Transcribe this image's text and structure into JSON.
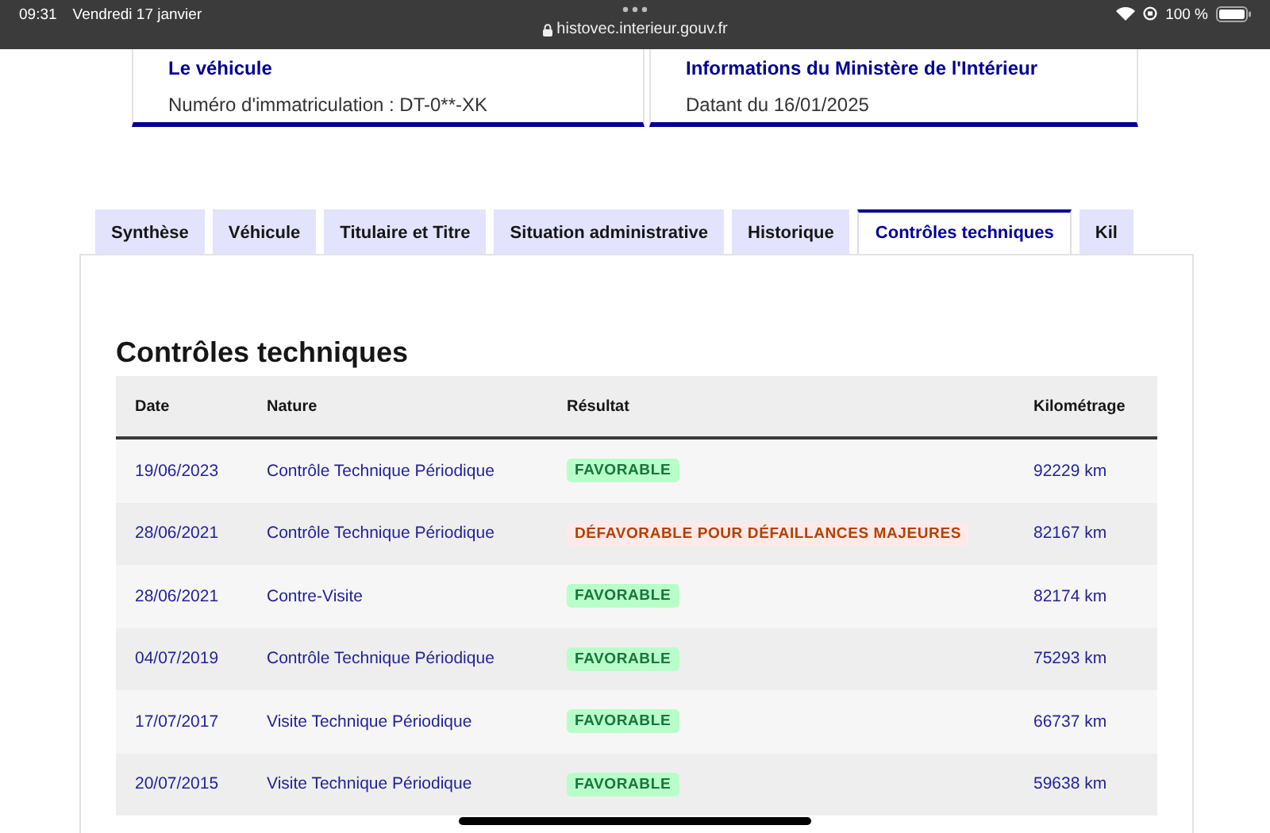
{
  "status_bar": {
    "time": "09:31",
    "date": "Vendredi 17 janvier",
    "url": "histovec.interieur.gouv.fr",
    "battery": "100 %"
  },
  "cards": [
    {
      "title": "Le véhicule",
      "text": "Numéro d'immatriculation : DT-0**-XK"
    },
    {
      "title": "Informations du Ministère de l'Intérieur",
      "text": "Datant du 16/01/2025"
    }
  ],
  "tabs": [
    {
      "label": "Synthèse",
      "selected": false
    },
    {
      "label": "Véhicule",
      "selected": false
    },
    {
      "label": "Titulaire et Titre",
      "selected": false
    },
    {
      "label": "Situation administrative",
      "selected": false
    },
    {
      "label": "Historique",
      "selected": false
    },
    {
      "label": "Contrôles techniques",
      "selected": true
    },
    {
      "label": "Kil",
      "selected": false
    }
  ],
  "section_title": "Contrôles techniques",
  "table": {
    "columns": [
      "Date",
      "Nature",
      "Résultat",
      "Kilométrage"
    ],
    "rows": [
      {
        "date": "19/06/2023",
        "nature": "Contrôle Technique Périodique",
        "result": "FAVORABLE",
        "kind": "favorable",
        "km": "92229 km"
      },
      {
        "date": "28/06/2021",
        "nature": "Contrôle Technique Périodique",
        "result": "DÉFAVORABLE POUR DÉFAILLANCES MAJEURES",
        "kind": "unfavorable",
        "km": "82167 km"
      },
      {
        "date": "28/06/2021",
        "nature": "Contre-Visite",
        "result": "FAVORABLE",
        "kind": "favorable",
        "km": "82174 km"
      },
      {
        "date": "04/07/2019",
        "nature": "Contrôle Technique Périodique",
        "result": "FAVORABLE",
        "kind": "favorable",
        "km": "75293 km"
      },
      {
        "date": "17/07/2017",
        "nature": "Visite Technique Périodique",
        "result": "FAVORABLE",
        "kind": "favorable",
        "km": "66737 km"
      },
      {
        "date": "20/07/2015",
        "nature": "Visite Technique Périodique",
        "result": "FAVORABLE",
        "kind": "favorable",
        "km": "59638 km"
      }
    ]
  }
}
